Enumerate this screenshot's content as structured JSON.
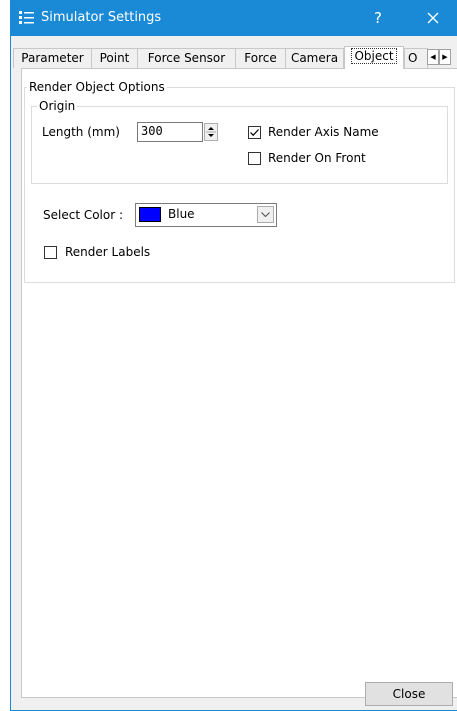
{
  "window": {
    "title": "Simulator Settings",
    "help": "?"
  },
  "tabs": [
    {
      "label": "Parameter"
    },
    {
      "label": "Point"
    },
    {
      "label": "Force Sensor"
    },
    {
      "label": "Force"
    },
    {
      "label": "Camera"
    },
    {
      "label": "Object",
      "active": true
    },
    {
      "label": "O"
    }
  ],
  "render_options": {
    "legend": "Render Object Options",
    "origin": {
      "legend": "Origin",
      "length_label": "Length (mm)",
      "length_value": "300",
      "render_axis_name": {
        "label": "Render Axis Name",
        "checked": true
      },
      "render_on_front": {
        "label": "Render On Front",
        "checked": false
      }
    },
    "select_color_label": "Select Color :",
    "color": {
      "name": "Blue",
      "value": "#0000ff"
    },
    "render_labels": {
      "label": "Render Labels",
      "checked": false
    }
  },
  "footer": {
    "close_label": "Close"
  },
  "colors": {
    "titlebar": "#1a8ad6",
    "dialog_bg": "#f0f0f0"
  }
}
